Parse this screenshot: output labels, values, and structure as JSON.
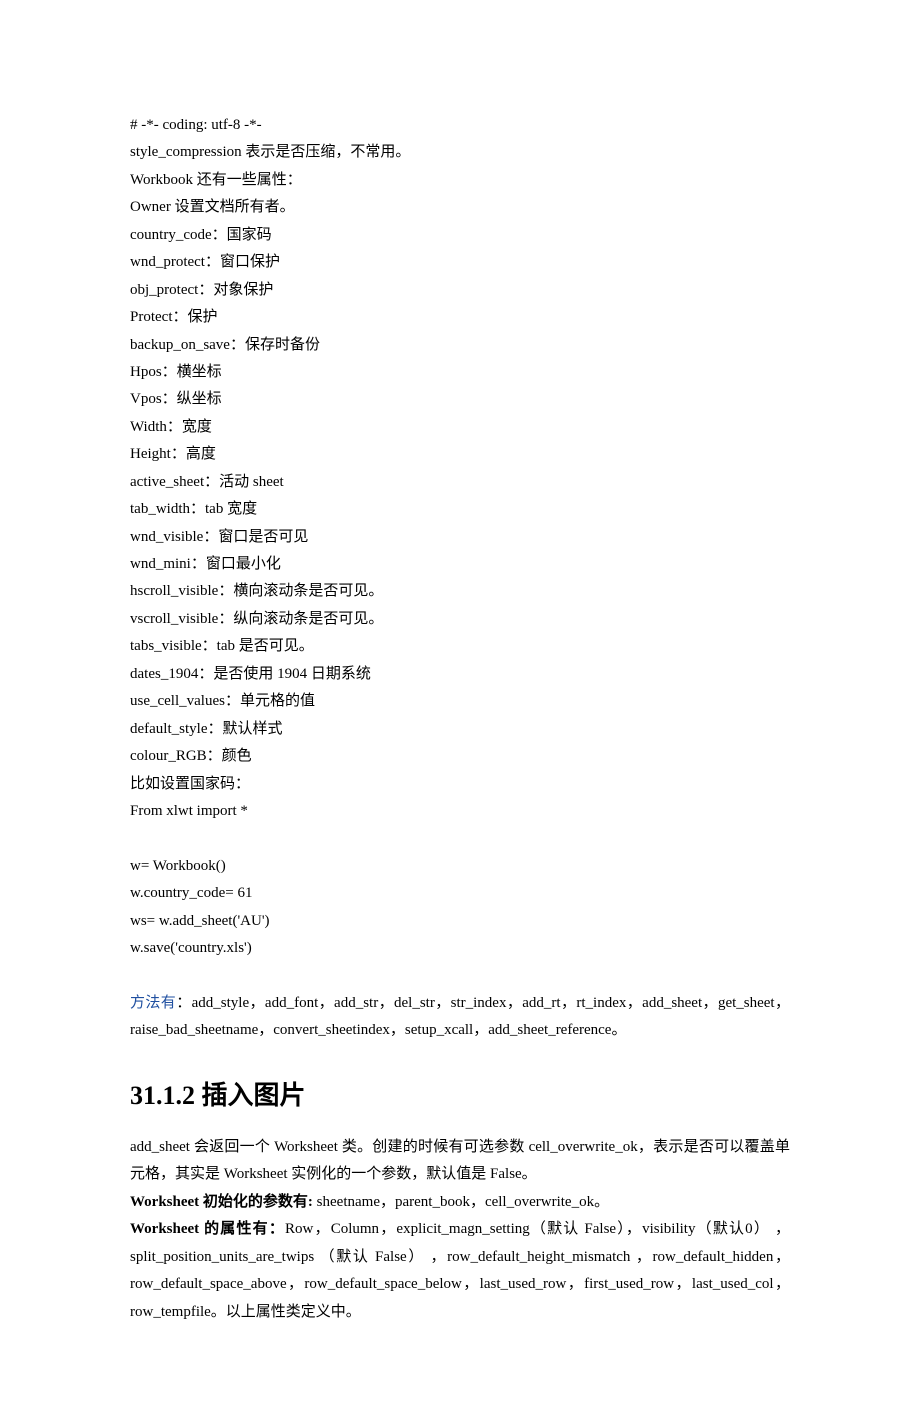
{
  "lines": [
    "# -*- coding: utf-8 -*-",
    "style_compression 表示是否压缩，不常用。",
    "Workbook 还有一些属性：",
    "Owner 设置文档所有者。",
    "country_code：国家码",
    "wnd_protect：窗口保护",
    "obj_protect：对象保护",
    "Protect：保护",
    "backup_on_save：保存时备份",
    "Hpos：横坐标",
    "Vpos：纵坐标",
    "Width：宽度",
    "Height：高度",
    "active_sheet：活动 sheet",
    "tab_width：tab 宽度",
    "wnd_visible：窗口是否可见",
    "wnd_mini：窗口最小化",
    "hscroll_visible：横向滚动条是否可见。",
    "vscroll_visible：纵向滚动条是否可见。",
    "tabs_visible：tab 是否可见。",
    "dates_1904：是否使用 1904 日期系统",
    "use_cell_values：单元格的值",
    "default_style：默认样式",
    "colour_RGB：颜色",
    "比如设置国家码：",
    "From xlwt import *"
  ],
  "code2": [
    "w= Workbook()",
    "w.country_code= 61",
    "ws= w.add_sheet('AU')",
    "w.save('country.xls')"
  ],
  "methods_label": "方法有",
  "methods_body": "：add_style，add_font，add_str，del_str，str_index，add_rt，rt_index，add_sheet，get_sheet，raise_bad_sheetname，convert_sheetindex，setup_xcall，add_sheet_reference。",
  "section_title": "31.1.2 插入图片",
  "p1": "add_sheet 会返回一个 Worksheet  类。创建的时候有可选参数 cell_overwrite_ok，表示是否可以覆盖单元格，其实是 Worksheet 实例化的一个参数，默认值是 False。",
  "p2_bold": "Worksheet 初始化的参数有:",
  "p2_rest": " sheetname，parent_book，cell_overwrite_ok。",
  "p3_bold": "Worksheet 的属性有：",
  "p3_rest": "Row，Column，explicit_magn_setting（默认 False），visibility（默认0） ，split_position_units_are_twips （默认 False） ，row_default_height_mismatch ，row_default_hidden，row_default_space_above，row_default_space_below，last_used_row，first_used_row，last_used_col，row_tempfile。以上属性类定义中。"
}
